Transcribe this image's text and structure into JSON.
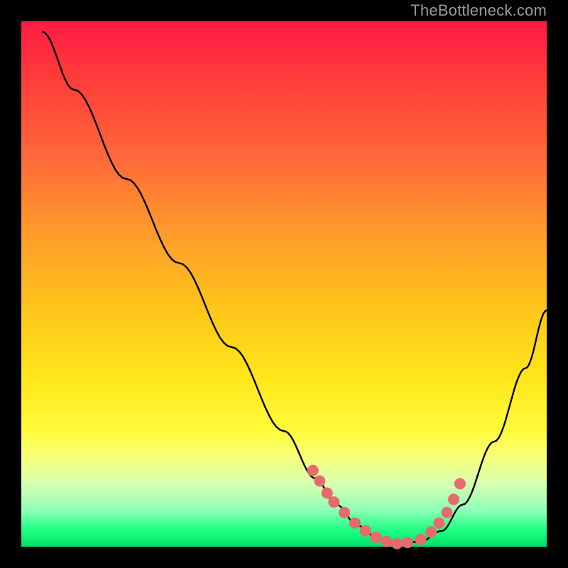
{
  "watermark": "TheBottleneck.com",
  "chart_data": {
    "type": "line",
    "title": "",
    "xlabel": "",
    "ylabel": "",
    "xlim": [
      0,
      100
    ],
    "ylim": [
      0,
      100
    ],
    "curve": {
      "x": [
        4,
        10,
        20,
        30,
        40,
        50,
        56,
        60,
        64,
        68,
        72,
        76,
        80,
        84,
        90,
        96,
        100
      ],
      "y": [
        98,
        87,
        70,
        54,
        38,
        22,
        13,
        8,
        4,
        1.5,
        0.5,
        1,
        3,
        8,
        20,
        34,
        45
      ]
    },
    "markers": {
      "x": [
        55.5,
        56.8,
        58.2,
        59.5,
        61.5,
        63.5,
        65.5,
        67.5,
        69.5,
        71.5,
        73.5,
        76,
        78,
        79.5,
        81,
        82.3,
        83.5
      ],
      "y": [
        14.5,
        12.5,
        10.2,
        8.5,
        6.5,
        4.5,
        3,
        1.8,
        1,
        0.6,
        0.8,
        1.4,
        2.8,
        4.5,
        6.5,
        9,
        12
      ]
    },
    "marker_color": "#e86a6a",
    "background_gradient": [
      "#ff1a44",
      "#ff9a2a",
      "#ffe61a",
      "#1aff80"
    ]
  }
}
